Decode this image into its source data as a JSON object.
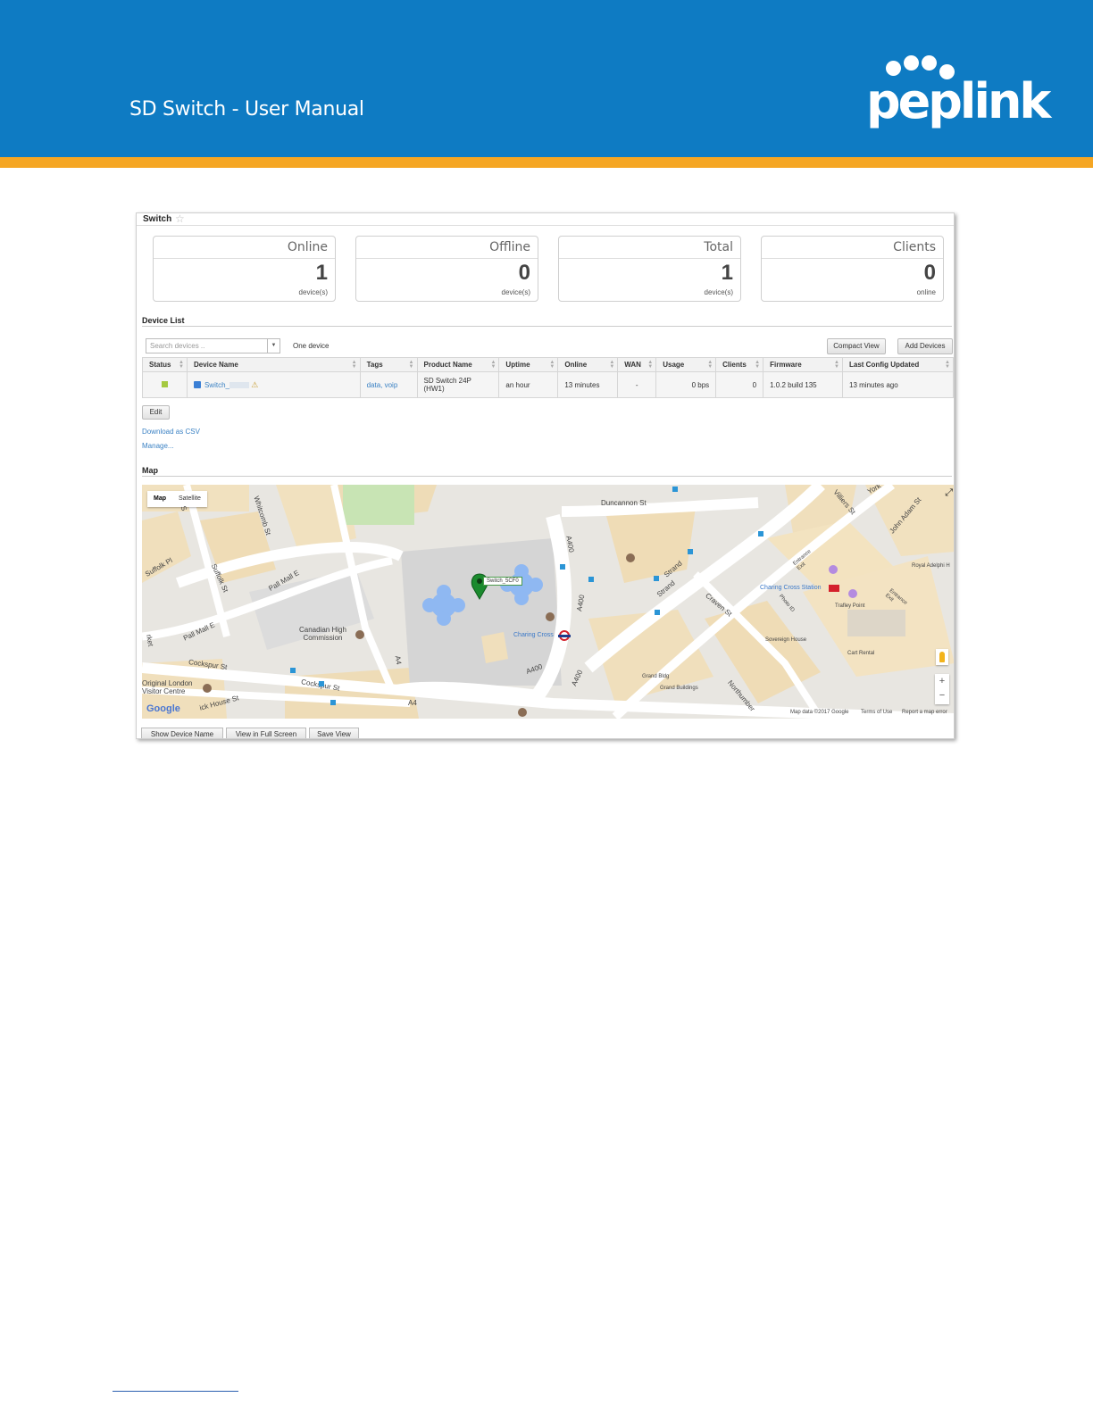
{
  "manual": {
    "title": "SD Switch  - User Manual",
    "brand": "peplink"
  },
  "page": {
    "title": "Switch"
  },
  "summary_cards": [
    {
      "label": "Online",
      "value": "1",
      "unit": "device(s)"
    },
    {
      "label": "Offline",
      "value": "0",
      "unit": "device(s)"
    },
    {
      "label": "Total",
      "value": "1",
      "unit": "device(s)"
    },
    {
      "label": "Clients",
      "value": "0",
      "unit": "online"
    }
  ],
  "device_list": {
    "heading": "Device List",
    "search_placeholder": "Search devices ..",
    "count_text": "One device",
    "compact_view_label": "Compact View",
    "add_devices_label": "Add Devices",
    "columns": [
      "Status",
      "Device Name",
      "Tags",
      "Product Name",
      "Uptime",
      "Online",
      "WAN",
      "Usage",
      "Clients",
      "Firmware",
      "Last Config Updated"
    ],
    "rows": [
      {
        "status_color": "#a5c940",
        "device_name": "Switch_",
        "tags": "data, voip",
        "product_name_line1": "SD Switch 24P",
        "product_name_line2": "(HW1)",
        "uptime": "an hour",
        "online": "13 minutes",
        "wan": "-",
        "usage": "0 bps",
        "clients": "0",
        "firmware": "1.0.2 build 135",
        "last_config_updated": "13 minutes ago"
      }
    ],
    "edit_label": "Edit",
    "download_csv_label": "Download as CSV",
    "manage_label": "Manage..."
  },
  "map": {
    "heading": "Map",
    "type_map_label": "Map",
    "type_satellite_label": "Satellite",
    "marker_label": "Switch_5CF0",
    "street_labels": {
      "duncannon": "Duncannon St",
      "whitcomb": "Whitcomb St",
      "suffolk_pl": "Suffolk Pl",
      "suffolk_st": "Suffolk St",
      "pall_mall_e1": "Pall Mall E",
      "pall_mall_e2": "Pall Mall E",
      "cockspur1": "Cockspur St",
      "cockspur2": "Cockspur St",
      "a4_1": "A4",
      "a4_2": "A4",
      "a400_1": "A400",
      "a400_2": "A400",
      "a400_3": "A400",
      "a400_4": "A400",
      "strand1": "Strand",
      "strand2": "Strand",
      "craven": "Craven St",
      "villiers": "Villiers St",
      "john_adam": "John Adam St",
      "york": "York",
      "northumberland": "Northumber",
      "s_top": "S"
    },
    "poi_labels": {
      "canadian": "Canadian High\nCommission",
      "charing_cross": "Charing Cross",
      "charing_cross_station": "Charing Cross Station",
      "original_london": "Original London\nVisitor Centre",
      "royal_adelphi": "Royal Adelphi H",
      "trafalgar_point": "Trafley Point",
      "sovereign_house": "Sovereign House",
      "cart_rental": "Cart Rental",
      "grand_bldg": "Grand Bldg",
      "grand_buildings": "Grand Buildings",
      "entrance_exit1": "Entrance\nExit",
      "entrance_exit2": "Entrance\nExit",
      "photo_id": "Photo ID",
      "market": "rket",
      "wick_house": "ick House St"
    },
    "google_label": "Google",
    "attribution": "Map data ©2017 Google",
    "terms_label": "Terms of Use",
    "report_label": "Report a map error",
    "zoom_in": "+",
    "zoom_out": "−",
    "show_device_name_label": "Show Device Name",
    "full_screen_label": "View in Full Screen",
    "save_view_label": "Save View"
  }
}
